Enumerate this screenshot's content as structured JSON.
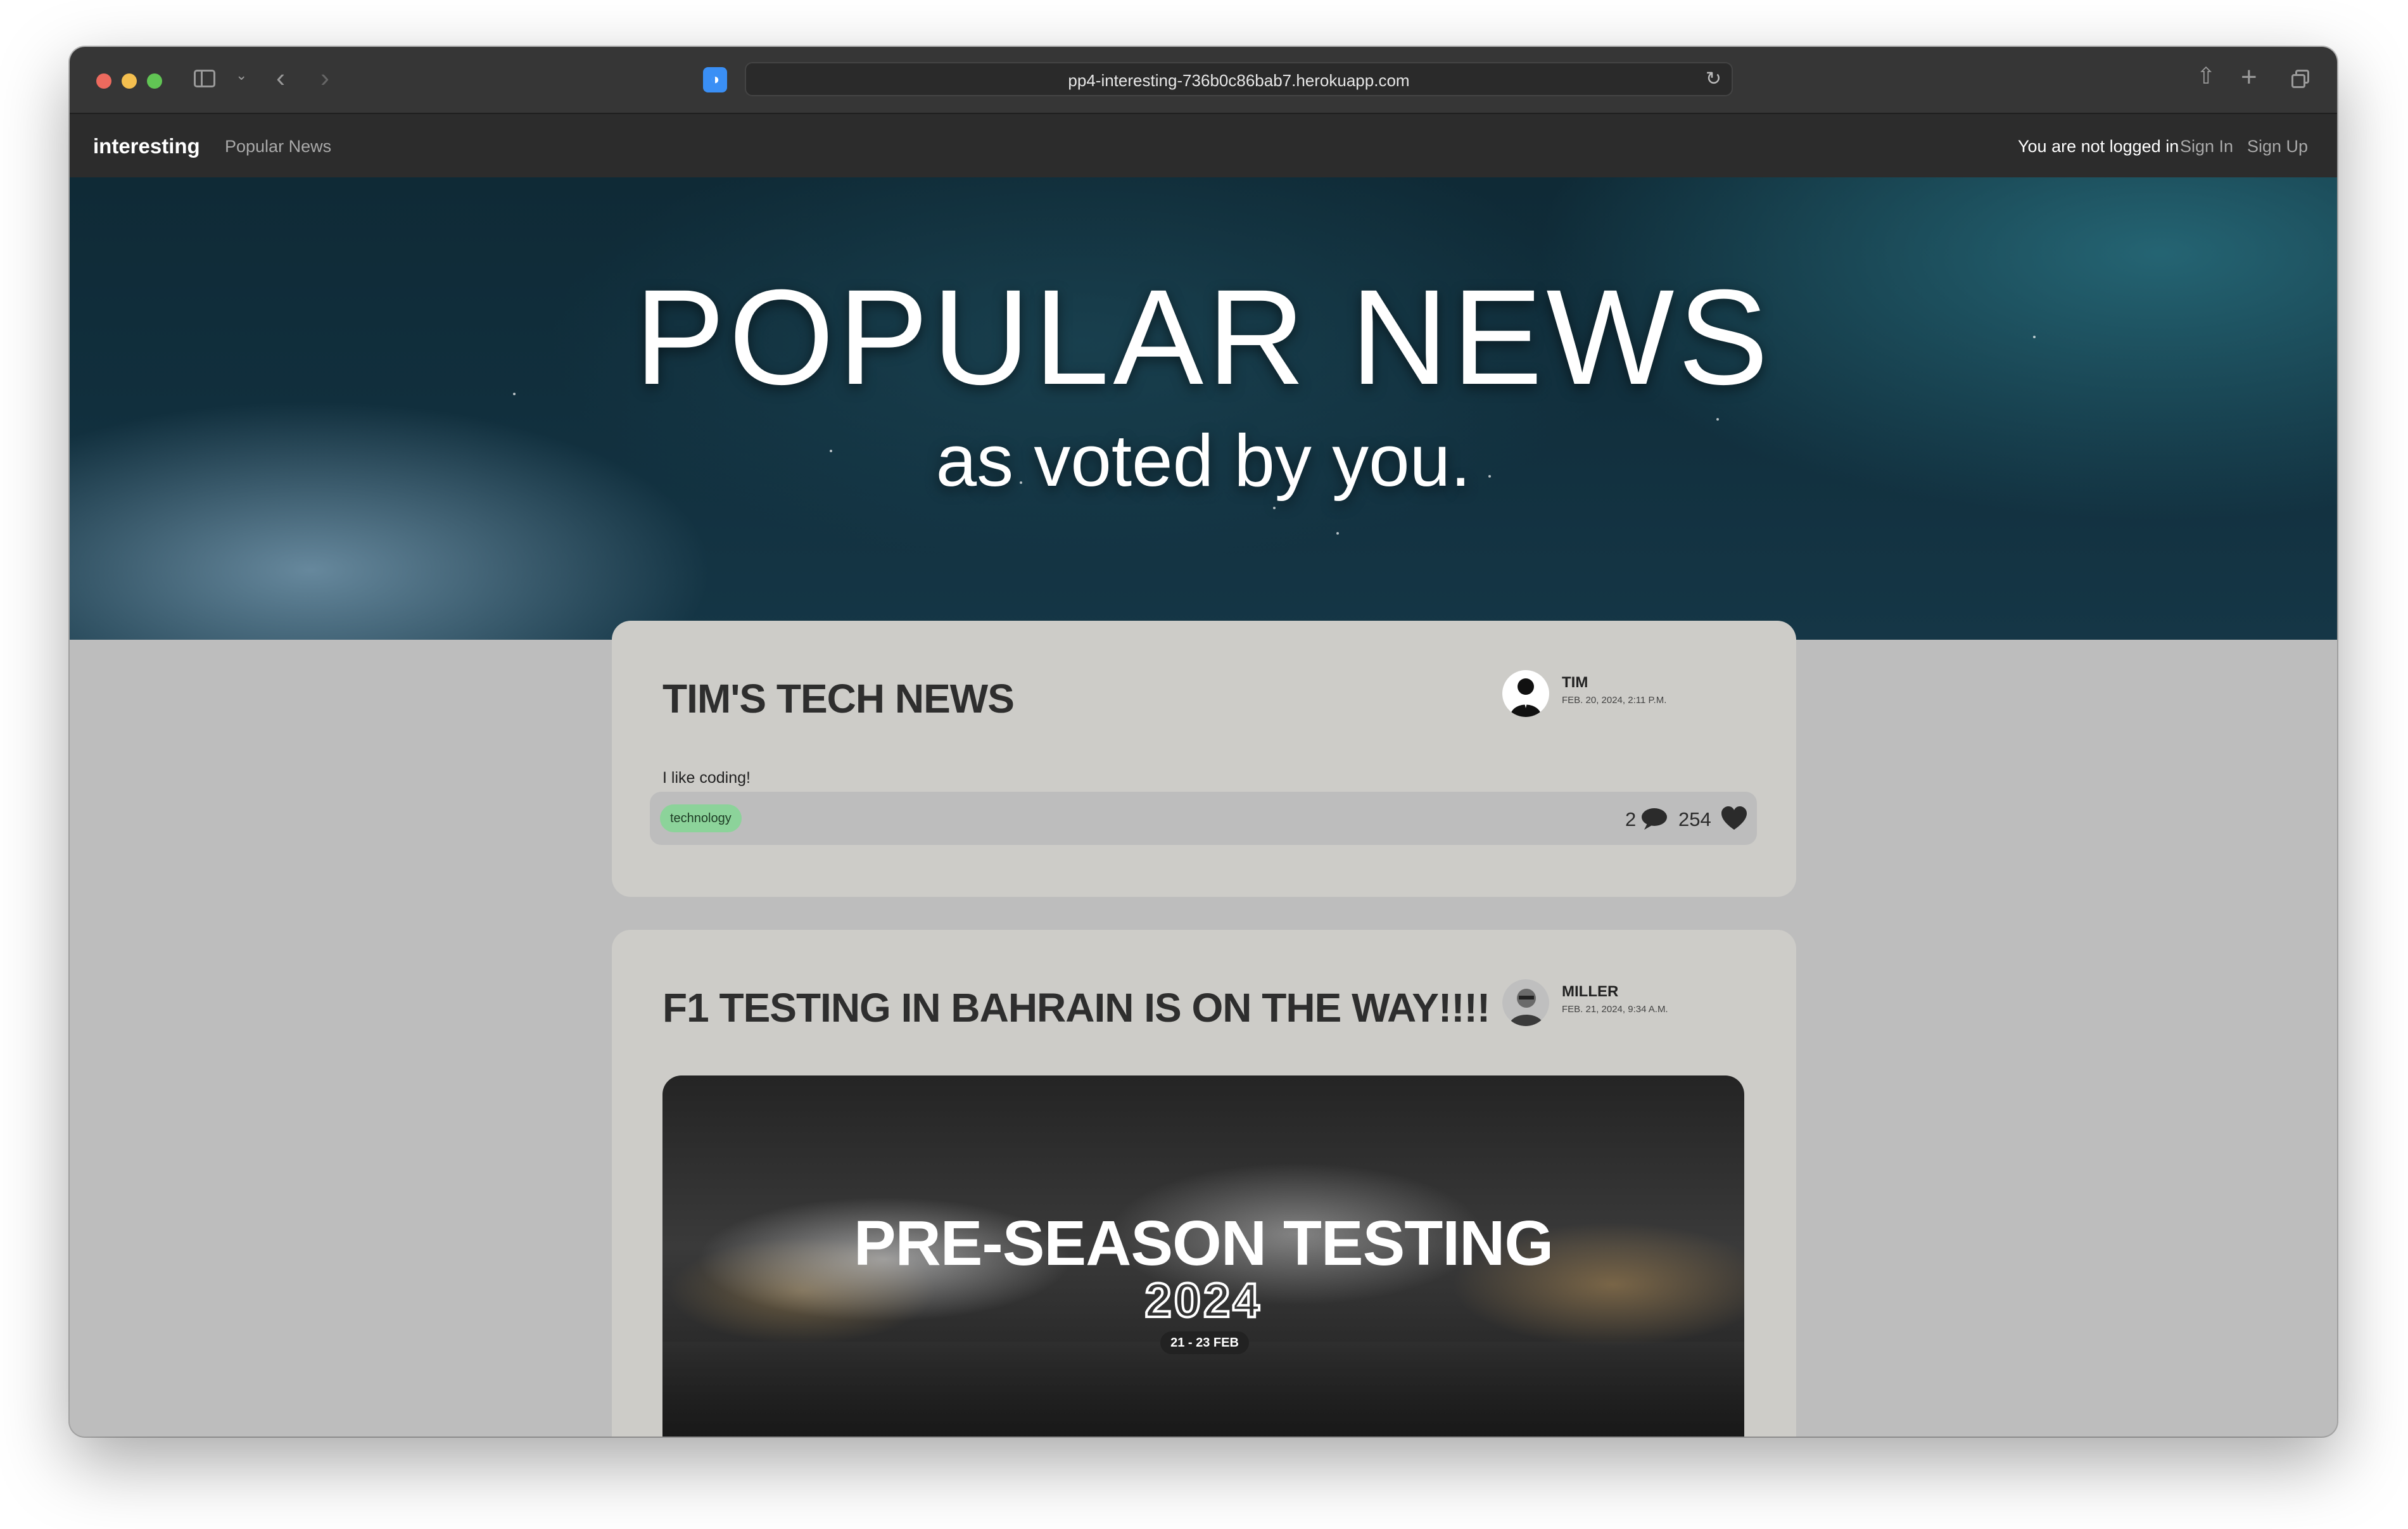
{
  "browser": {
    "url": "pp4-interesting-736b0c86bab7.herokuapp.com",
    "traffic_lights": {
      "close": "#ed6a5e",
      "minimize": "#f4bf4f",
      "zoom": "#61c554"
    },
    "icons": [
      "sidebar-icon",
      "chevron-down-icon",
      "back-icon",
      "forward-icon",
      "password-shield-icon",
      "reload-icon",
      "share-icon",
      "new-tab-icon",
      "tab-overview-icon"
    ]
  },
  "navbar": {
    "brand": "interesting",
    "links": [
      "Popular News"
    ],
    "status": "You are not logged in",
    "sign_in": "Sign In",
    "sign_up": "Sign Up"
  },
  "hero": {
    "title": "POPULAR NEWS",
    "subtitle": "as voted by you."
  },
  "posts": [
    {
      "title": "TIM'S TECH NEWS",
      "author": "TIM",
      "date": "FEB. 20, 2024, 2:11 P.M.",
      "excerpt": "I like coding!",
      "tag": "technology",
      "tag_color": "#8cd39a",
      "comments": "2",
      "likes": "254"
    },
    {
      "title": "F1 TESTING IN BAHRAIN IS ON THE WAY!!!!",
      "author": "MILLER",
      "date": "FEB. 21, 2024, 9:34 A.M.",
      "image": {
        "title": "PRE-SEASON TESTING",
        "year": "2024",
        "dates": "21 - 23 FEB"
      }
    }
  ]
}
